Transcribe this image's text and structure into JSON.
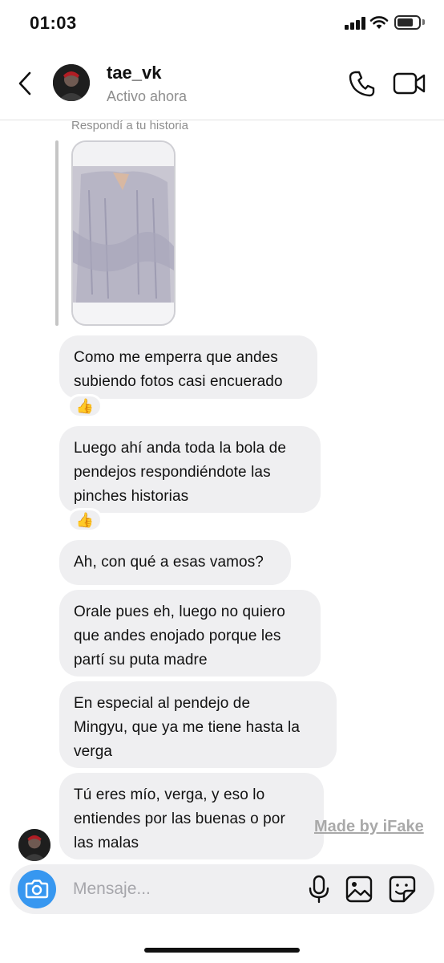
{
  "status_bar": {
    "time": "01:03"
  },
  "header": {
    "username": "tae_vk",
    "status": "Activo ahora"
  },
  "story_reply": {
    "label": "Respondí a tu historia"
  },
  "messages": [
    {
      "line1": "Como me emperra que andes",
      "line2": "subiendo fotos casi encuerado",
      "reaction": "👍"
    },
    {
      "line1": "Luego ahí anda toda la bola de",
      "line2": "pendejos respondiéndote las",
      "line3": "pinches historias",
      "reaction": "👍"
    },
    {
      "line1": "Ah, con qué a esas vamos?"
    },
    {
      "line1": "Orale pues eh, luego no quiero",
      "line2": "que andes enojado porque les",
      "line3": "partí su puta madre"
    },
    {
      "line1": "En especial al pendejo de",
      "line2": "Mingyu, que ya me tiene hasta la",
      "line3": "verga"
    },
    {
      "line1": "Tú eres mío, verga, y eso lo",
      "line2": "entiendes por las buenas o por",
      "line3": "las malas"
    }
  ],
  "watermark": "Made by iFake",
  "composer": {
    "placeholder": "Mensaje..."
  },
  "icons": {
    "back": "chevron-left-icon",
    "call": "phone-icon",
    "video": "video-camera-icon",
    "camera": "camera-icon",
    "mic": "microphone-icon",
    "gallery": "image-icon",
    "sticker": "sticker-icon"
  },
  "colors": {
    "accent": "#3797f0",
    "bubble": "#efeff1",
    "muted": "#8e8e8e"
  }
}
